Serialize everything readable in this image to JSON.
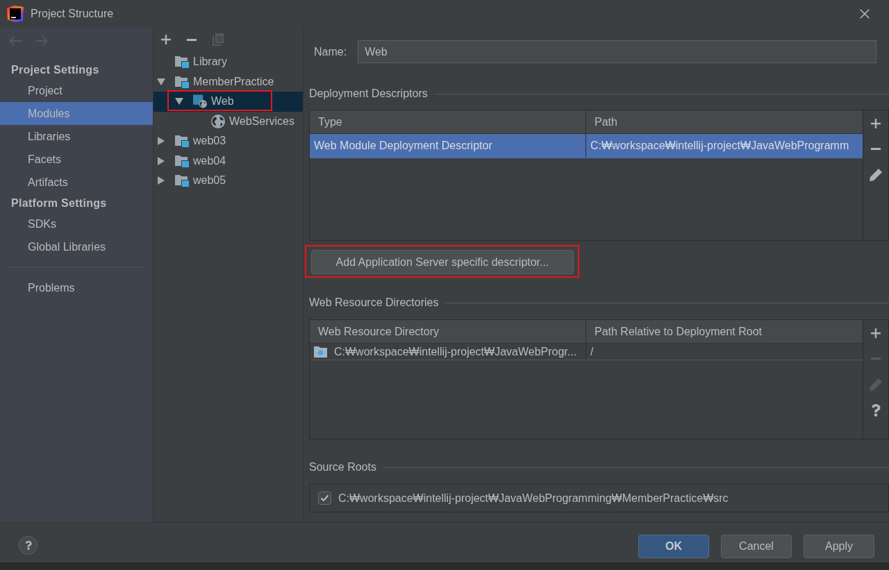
{
  "window": {
    "title": "Project Structure"
  },
  "navigation": [
    {
      "kind": "back",
      "disabled": true
    },
    {
      "kind": "forward",
      "disabled": true
    }
  ],
  "sidebar": {
    "groups": [
      {
        "title": "Project Settings",
        "items": [
          {
            "label": "Project",
            "selected": false
          },
          {
            "label": "Modules",
            "selected": true
          },
          {
            "label": "Libraries",
            "selected": false
          },
          {
            "label": "Facets",
            "selected": false
          },
          {
            "label": "Artifacts",
            "selected": false
          }
        ]
      },
      {
        "title": "Platform Settings",
        "items": [
          {
            "label": "SDKs",
            "selected": false
          },
          {
            "label": "Global Libraries",
            "selected": false
          }
        ]
      }
    ],
    "footer_items": [
      {
        "label": "Problems",
        "selected": false
      }
    ]
  },
  "tree": {
    "toolbar": [
      {
        "kind": "add",
        "disabled": false
      },
      {
        "kind": "remove",
        "disabled": false
      },
      {
        "kind": "copy",
        "disabled": true
      }
    ],
    "items": [
      {
        "label": "Library",
        "kind": "module",
        "selected": false
      },
      {
        "label": "MemberPractice",
        "kind": "module",
        "expanded": true,
        "selected": false,
        "children": [
          {
            "label": "Web",
            "kind": "web",
            "expanded": true,
            "selected": true,
            "highlighted": true,
            "children": [
              {
                "label": "WebServices",
                "kind": "web-services",
                "selected": false
              }
            ]
          }
        ]
      },
      {
        "label": "web03",
        "kind": "module",
        "expanded": false,
        "selected": false
      },
      {
        "label": "web04",
        "kind": "module",
        "expanded": false,
        "selected": false
      },
      {
        "label": "web05",
        "kind": "module",
        "expanded": false,
        "selected": false
      }
    ]
  },
  "details": {
    "name": {
      "label": "Name:",
      "value": "Web"
    },
    "deployment_descriptors": {
      "title": "Deployment Descriptors",
      "columns": [
        "Type",
        "Path"
      ],
      "rows": [
        {
          "cells": [
            "Web Module Deployment Descriptor",
            "C:₩workspace₩intellij-project₩JavaWebProgramm"
          ],
          "selected": true
        }
      ],
      "tools": [
        {
          "kind": "add",
          "disabled": false
        },
        {
          "kind": "remove",
          "disabled": false
        },
        {
          "kind": "edit",
          "disabled": false
        }
      ]
    },
    "add_descriptor_button": {
      "label": "Add Application Server specific descriptor...",
      "highlighted": true
    },
    "web_resource_directories": {
      "title": "Web Resource Directories",
      "columns": [
        "Web Resource Directory",
        "Path Relative to Deployment Root"
      ],
      "rows": [
        {
          "cells": [
            "C:₩workspace₩intellij-project₩JavaWebProgr...",
            "/"
          ],
          "selected": false
        }
      ],
      "tools": [
        {
          "kind": "add",
          "disabled": false
        },
        {
          "kind": "remove",
          "disabled": true
        },
        {
          "kind": "edit",
          "disabled": true
        },
        {
          "kind": "help",
          "disabled": false
        }
      ]
    },
    "source_roots": {
      "title": "Source Roots",
      "items": [
        {
          "path": "C:₩workspace₩intellij-project₩JavaWebProgramming₩MemberPractice₩src",
          "checked": true
        }
      ]
    }
  },
  "footer": {
    "buttons": [
      {
        "label": "OK",
        "kind": "default"
      },
      {
        "label": "Cancel",
        "kind": "normal"
      },
      {
        "label": "Apply",
        "kind": "normal"
      }
    ]
  }
}
